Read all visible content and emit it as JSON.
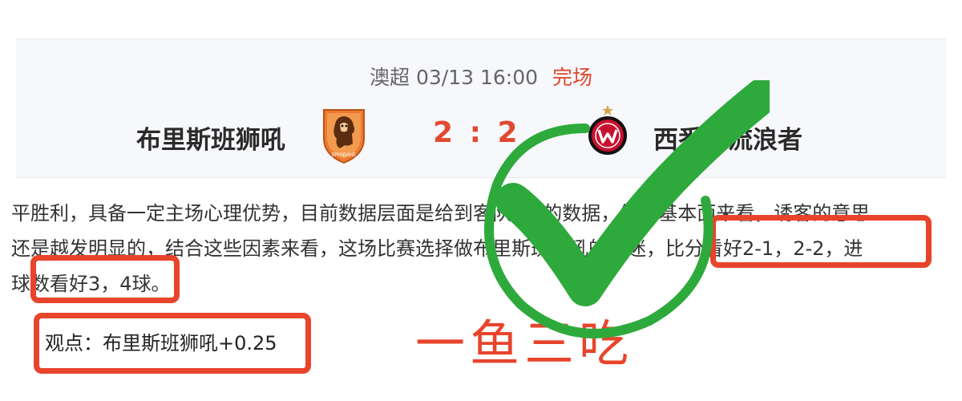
{
  "match": {
    "league": "澳超",
    "datetime": "03/13 16:00",
    "status": "完场",
    "home_team": "布里斯班狮吼",
    "away_team": "西悉尼流浪者",
    "score": "2 : 2",
    "home_logo_icon": "brisbane-roar-lion-crest-icon",
    "away_logo_icon": "wanderers-badge-icon"
  },
  "article": {
    "lines": [
      "平胜利，具备一定主场心理优势，目前数据层面是给到客队1档的数据，结合基本面来看，诱客的意思",
      "还是越发明显的，结合这些因素来看，这场比赛选择做布里斯班狮吼的球迷，比分看好2-1，2-2，进",
      "球数看好3，4球。"
    ]
  },
  "view": "观点：布里斯班狮吼+0.25",
  "annotation": {
    "slogan": "一鱼三吃",
    "check_icon": "green-checkmark-icon",
    "colors": {
      "red": "#e8442c",
      "green": "#2eaa3c",
      "score": "#e04a32",
      "status": "#e0452a"
    }
  }
}
